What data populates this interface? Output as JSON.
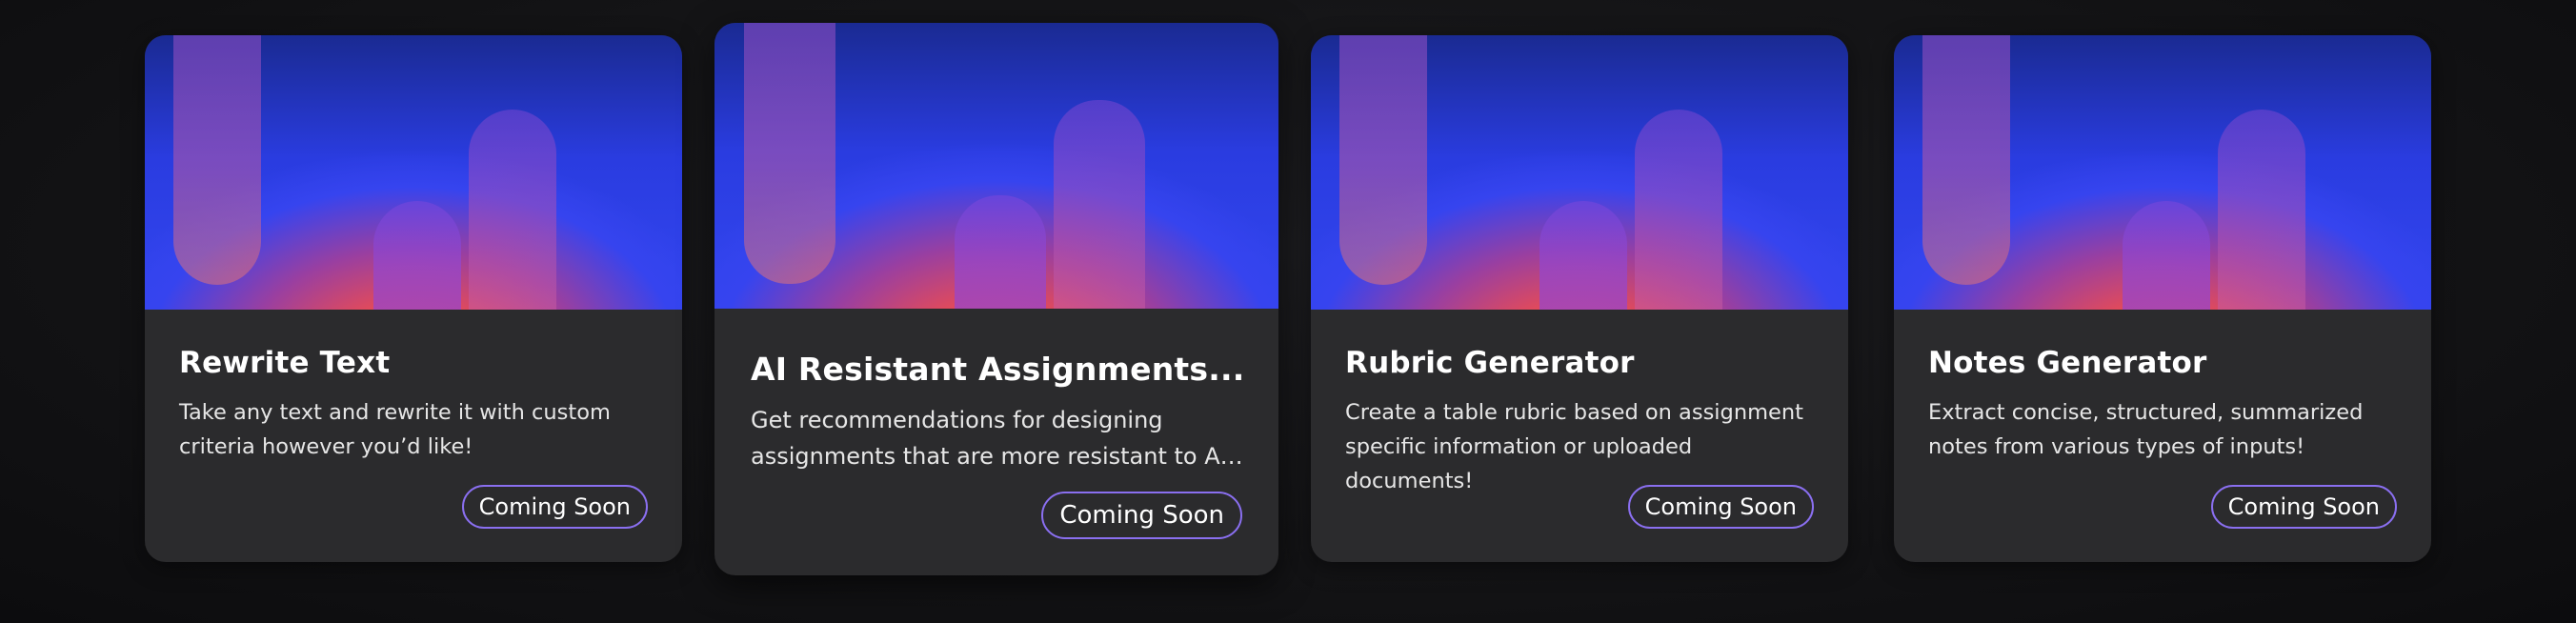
{
  "cards": [
    {
      "title": "Rewrite Text",
      "description": "Take any text and rewrite it with custom criteria however you’d like!",
      "button_label": "Coming Soon"
    },
    {
      "title": "AI Resistant Assignments...",
      "description_line1": "Get recommendations for designing",
      "description_line2": "assignments that are more resistant to AI-...",
      "button_label": "Coming Soon"
    },
    {
      "title": "Rubric Generator",
      "description": "Create a table rubric based on assignment specific information or uploaded documents!",
      "button_label": "Coming Soon"
    },
    {
      "title": "Notes Generator",
      "description": "Extract concise, structured, summarized notes from various types of inputs!",
      "button_label": "Coming Soon"
    }
  ],
  "colors": {
    "page_background": "#141416",
    "card_background": "#2b2b2d",
    "button_border": "#8a6ff0",
    "banner_blue": "#3346f0",
    "banner_orange": "#f25a3c"
  }
}
